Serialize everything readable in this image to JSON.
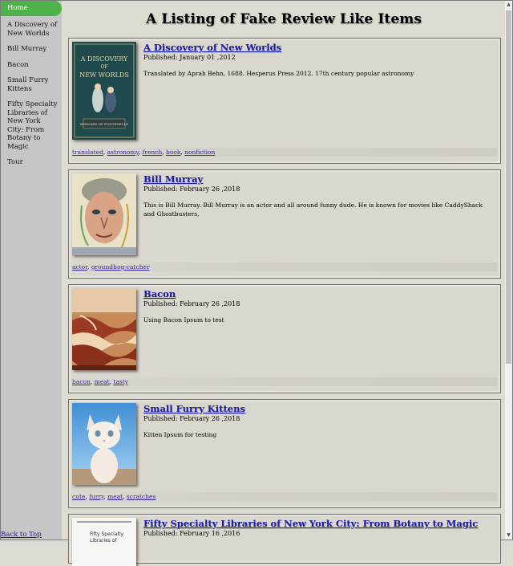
{
  "sidebar": {
    "home": "Home",
    "items": [
      {
        "label": "A Discovery of New Worlds"
      },
      {
        "label": "Bill Murray"
      },
      {
        "label": "Bacon"
      },
      {
        "label": "Small Furry Kittens"
      },
      {
        "label": "Fifty Specialty Libraries of New York City: From Botany to Magic"
      },
      {
        "label": "Tour"
      }
    ],
    "back_to_top": "Back to Top"
  },
  "main": {
    "title": "A Listing of Fake Review Like Items",
    "cards": [
      {
        "title": "A Discovery of New Worlds",
        "date": "Published: January 01 ,2012",
        "description": "Translated by Aprah Behn, 1688. Hesperus Press 2012. 17th century popular astronomy",
        "image": "book-cover-discovery",
        "image_text": [
          "A DISCOVERY",
          "OF",
          "NEW WORLDS",
          "BERNARD DE FONTENELLE"
        ],
        "tags": [
          "translated",
          "astronomy",
          "french",
          "book",
          "nonfiction"
        ]
      },
      {
        "title": "Bill Murray",
        "date": "Published: February 26 ,2018",
        "description": "This is Bill Murray. Bill Murray is an actor and all around funny dude. He is known for movies like CaddyShack and Ghostbusters,",
        "image": "bill-murray-painting",
        "tags": [
          "actor",
          "groundhog-catcher"
        ]
      },
      {
        "title": "Bacon",
        "date": "Published: February 26 ,2018",
        "description": "Using Bacon Ipsum to test",
        "image": "bacon-photo",
        "tags": [
          "bacon",
          "meat",
          "tasty"
        ]
      },
      {
        "title": "Small Furry Kittens",
        "date": "Published: February 26 ,2018",
        "description": "Kitten Ipsum for testing",
        "image": "kitten-photo",
        "tags": [
          "cute",
          "furry",
          "meat",
          "scratches"
        ]
      },
      {
        "title": "Fifty Specialty Libraries of New York City: From Botany to Magic",
        "date": "Published: February 16 ,2016",
        "description": "",
        "image": "book-cover-fifty-libraries",
        "image_text": [
          "Fifty Specialty",
          "Libraries of"
        ],
        "tags": []
      }
    ]
  },
  "colors": {
    "background": "#dedbd3",
    "sidebar": "#c6c6c6",
    "home_accent": "#4eb14a",
    "link": "#1a1aa8",
    "tag_link": "#3a22a0"
  }
}
